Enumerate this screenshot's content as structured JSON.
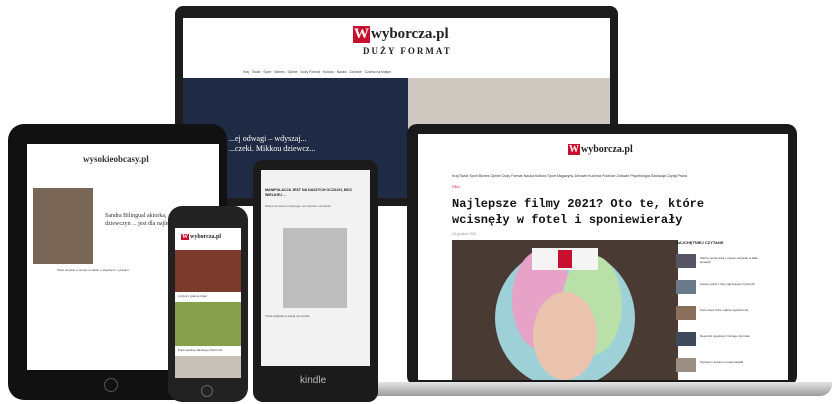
{
  "desktop": {
    "logo": "wyborcza.pl",
    "subtitle": "DUŻY FORMAT",
    "hero_text": "...ej odwagi – wdyszaj... ...czeki. Mikkou dziewcz...",
    "nav_items": [
      "Kraj",
      "Świat",
      "Sport",
      "Biznes",
      "Opinie",
      "Duży Format",
      "Kultura",
      "Nauka",
      "Zdrowie",
      "Czarno na białym"
    ]
  },
  "laptop": {
    "logo": "wyborcza.pl",
    "nav_items": [
      "Kraj",
      "Świat",
      "Sport",
      "Biznes",
      "Opinie",
      "Duży Format",
      "Nauka",
      "Kultura",
      "Sport",
      "Magazyny",
      "Zdrowie",
      "Kuchnia",
      "Podróże",
      "Zdrowie",
      "Psychologia",
      "Edukacja",
      "Czytaj",
      "Praca"
    ],
    "category": "Film",
    "headline": "Najlepsze filmy 2021? Oto te, które wcisnęły w fotel i sponiewierały",
    "meta": "15 grudnia 2021",
    "sidebar_title": "NAJCHĘTNIEJ CZYTANE",
    "sidebar_items": [
      "Ważny temat dnia z opisem artykułu w kilku słowach",
      "Kolejny tekst z listy najczęściej czytanych",
      "Komentarz dnia i ważne wydarzenia",
      "Reportaż tygodnia z Dużego Formatu",
      "Wywiad z autorem nowej książki"
    ]
  },
  "tablet": {
    "logo": "wysokieobcasy.pl",
    "headline": "Sandra Bilingual aktorka, ... manipulacji dziewczyn ... jest dla najlepszej ...",
    "body": "Tekst artykułu w wersji na tablet z akapitami i cytatami."
  },
  "kindle": {
    "headline": "MANIPULACJA JEST NA NASZYCH OCZACH, MOC WIELKIEJ ...",
    "text": "Wstęp do tekstu czytanego na czytniku e-booków.",
    "body": "Treść artykułu w wersji na czytnik.",
    "brand": "kindle"
  },
  "phone": {
    "logo": "wyborcza.pl",
    "caption1": "Artykuł z galerią zdjęć",
    "caption2": "Ptasi siedlisk dalekiego Wschodu",
    "logo_mark": "W"
  },
  "colors": {
    "brand_red": "#c8102e",
    "device_black": "#1a1a1a"
  }
}
